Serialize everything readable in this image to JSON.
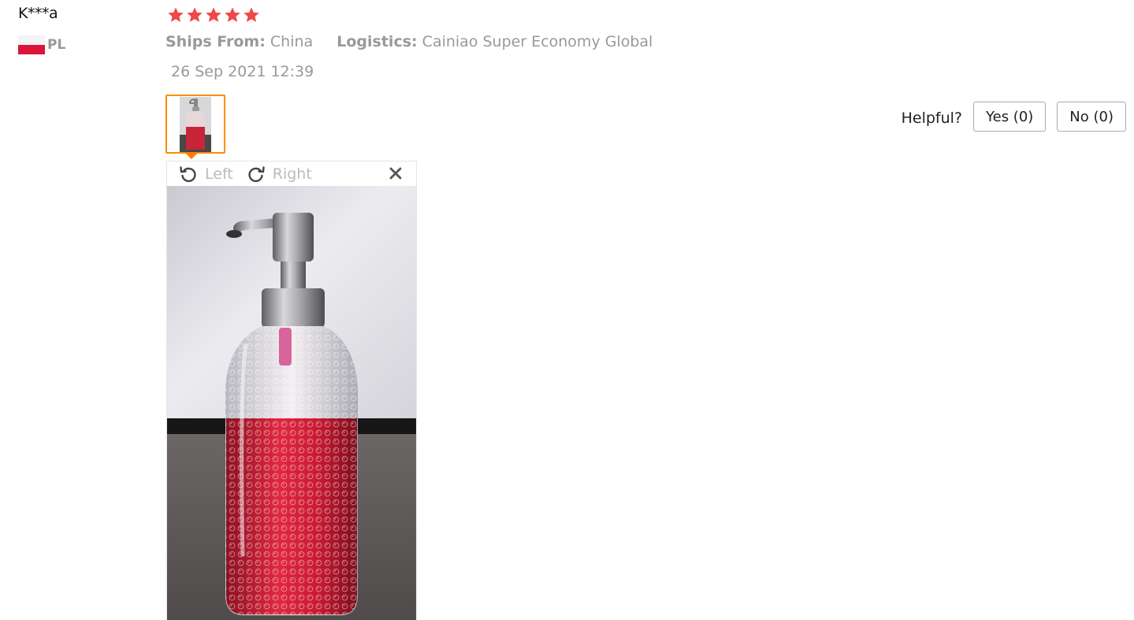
{
  "review": {
    "user_name": "K***a",
    "country_code": "PL",
    "rating": 5,
    "ships_from_label": "Ships From:",
    "ships_from_value": "China",
    "logistics_label": "Logistics:",
    "logistics_value": "Cainiao Super Economy Global",
    "date": "26 Sep 2021 12:39"
  },
  "viewer": {
    "rotate_left_label": "Left",
    "rotate_right_label": "Right"
  },
  "helpful": {
    "label": "Helpful?",
    "yes_label": "Yes (0)",
    "no_label": "No (0)"
  },
  "colors": {
    "star": "#f04848",
    "thumb_border": "#ff8c00",
    "flag_red": "#dc143c"
  },
  "icons": [
    "star-icon",
    "flag-pl-icon",
    "rotate-left-icon",
    "rotate-right-icon",
    "close-icon"
  ]
}
